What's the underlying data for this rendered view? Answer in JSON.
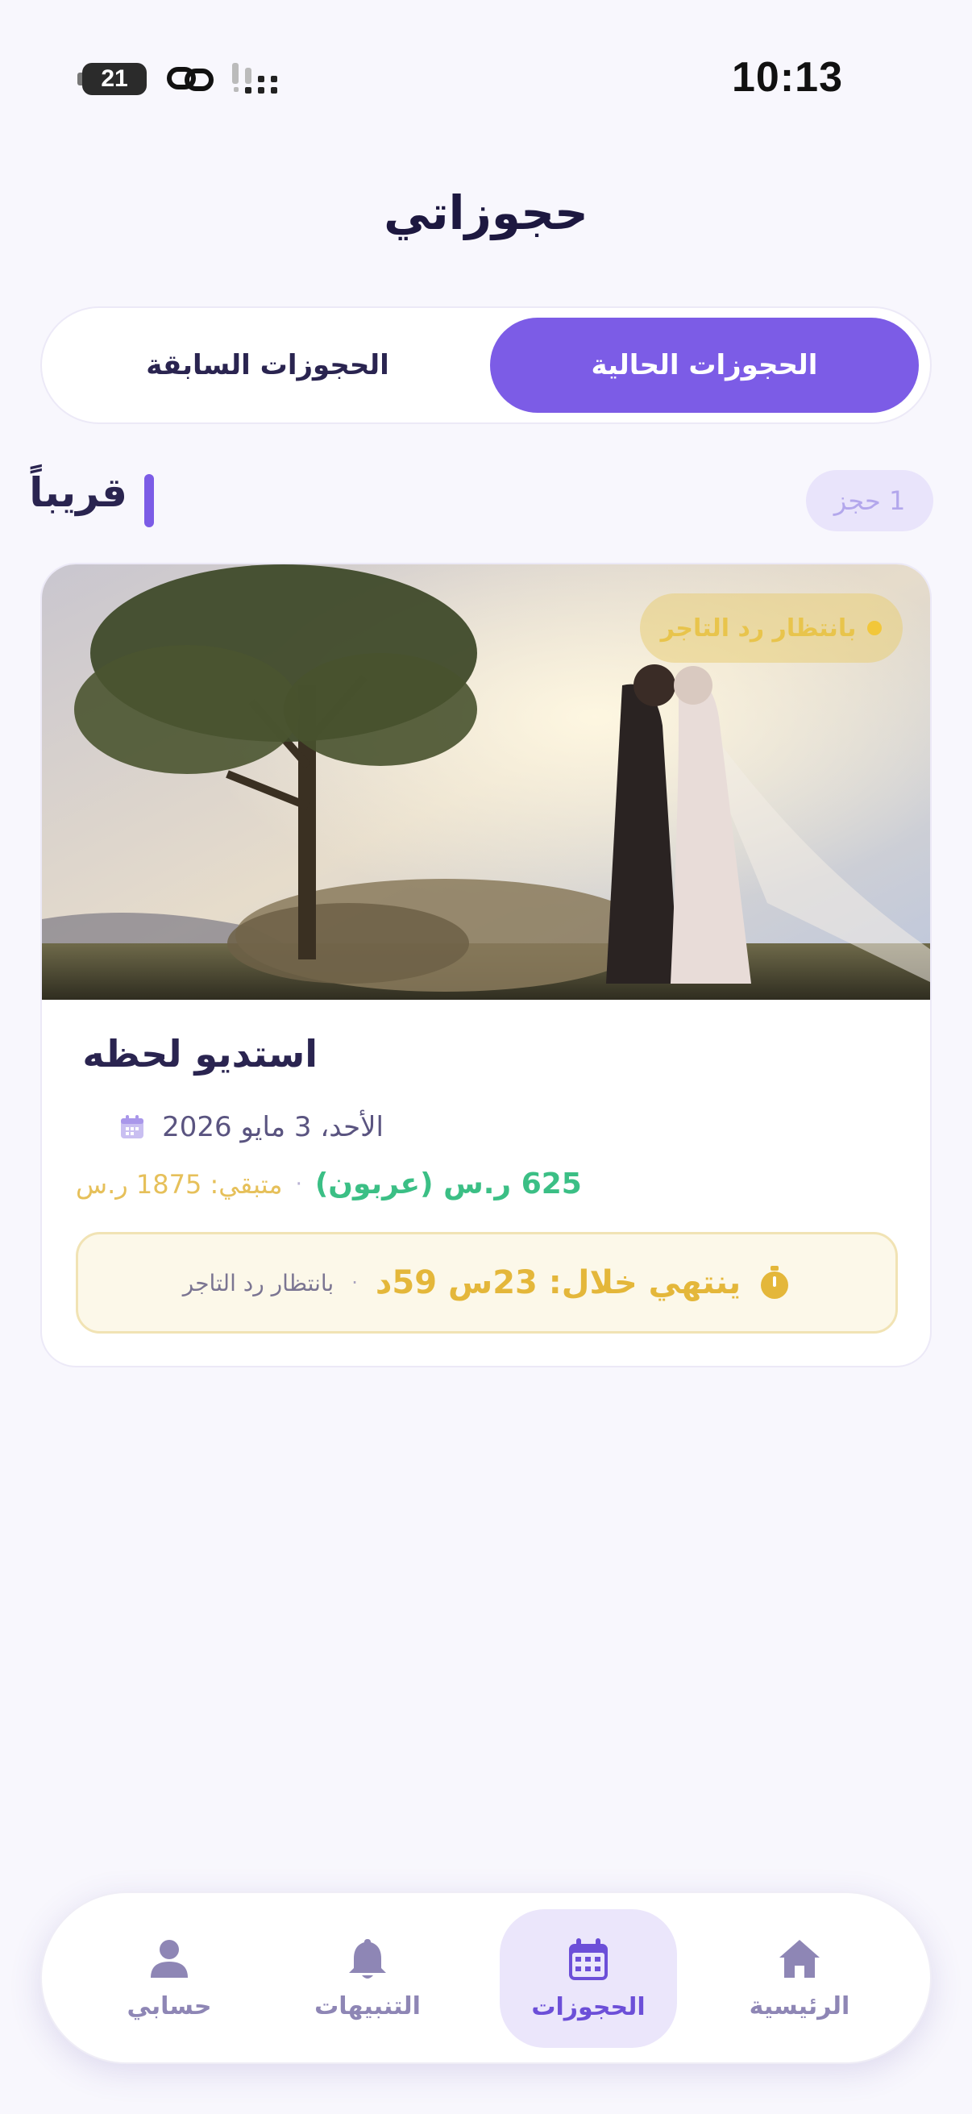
{
  "status_bar": {
    "time": "10:13",
    "battery": "21"
  },
  "header": {
    "title": "حجوزاتي"
  },
  "tabs": {
    "current": "الحجوزات الحالية",
    "past": "الحجوزات السابقة"
  },
  "section": {
    "title": "قريباً",
    "count": "1 حجز"
  },
  "booking": {
    "status": "بانتظار رد التاجر",
    "studio_name": "استديو لحظه",
    "date": "الأحد، 3 مايو 2026",
    "paid": "625 ر.س (عربون)",
    "separator": "·",
    "remaining": "متبقي: 1875 ر.س",
    "timer_text": "ينتهي خلال: 23س 59د",
    "timer_note": "بانتظار رد التاجر"
  },
  "nav": {
    "home": "الرئيسية",
    "bookings": "الحجوزات",
    "notifications": "التنبيهات",
    "account": "حسابي"
  },
  "colors": {
    "accent": "#7c5ce6",
    "paid": "#3bbf85",
    "pending": "#e4b73a"
  }
}
